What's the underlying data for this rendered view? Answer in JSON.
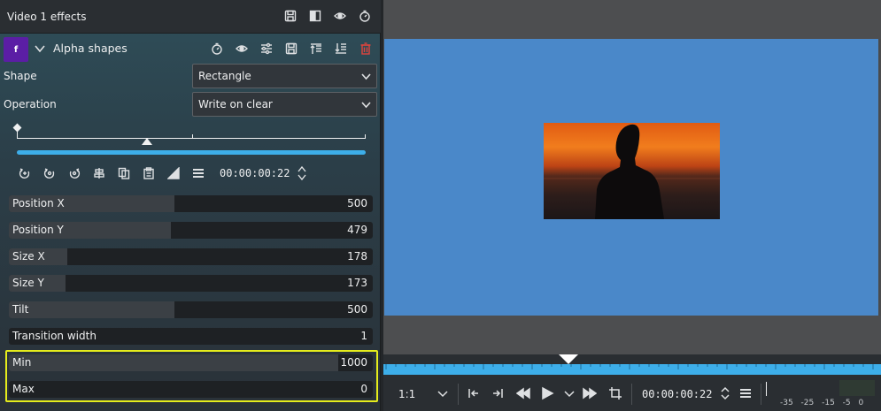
{
  "effects_panel": {
    "title": "Video 1 effects",
    "header_icons": [
      "save-effect-icon",
      "split-compare-icon",
      "show-effect-icon",
      "timer-icon"
    ]
  },
  "effect": {
    "badge": "f",
    "name": "Alpha shapes",
    "icons": [
      "keyframe-timer-icon",
      "eye-icon",
      "sliders-icon",
      "save-icon",
      "move-up-icon",
      "move-down-icon",
      "delete-icon"
    ],
    "shape": {
      "label": "Shape",
      "value": "Rectangle"
    },
    "operation": {
      "label": "Operation",
      "value": "Write on clear"
    },
    "keyframe_time": "00:00:00:22",
    "keyframe_toolbar_icons": [
      "add-keyframe-icon",
      "previous-keyframe-icon",
      "next-keyframe-icon",
      "center-icon",
      "copy-icon",
      "paste-icon",
      "curve-icon",
      "menu-icon"
    ],
    "params": [
      {
        "name": "Position X",
        "value": "500",
        "fill": 0.455
      },
      {
        "name": "Position Y",
        "value": "479",
        "fill": 0.445
      },
      {
        "name": "Size X",
        "value": "178",
        "fill": 0.16
      },
      {
        "name": "Size Y",
        "value": "173",
        "fill": 0.155
      },
      {
        "name": "Tilt",
        "value": "500",
        "fill": 0.455
      },
      {
        "name": "Transition width",
        "value": "1",
        "fill": 0.0
      },
      {
        "name": "Min",
        "value": "1000",
        "fill": 0.905
      },
      {
        "name": "Max",
        "value": "0",
        "fill": 0.0
      }
    ]
  },
  "monitor": {
    "zoom": "1:1",
    "timecode": "00:00:00:22",
    "vu_scale": "-35 -25 -15 -5 0"
  },
  "colors": {
    "accent": "#3daee9",
    "effect_badge": "#5b1ea5",
    "highlight": "#e5ec1c",
    "canvas": "#4a88c9",
    "delete": "#e0443d"
  }
}
